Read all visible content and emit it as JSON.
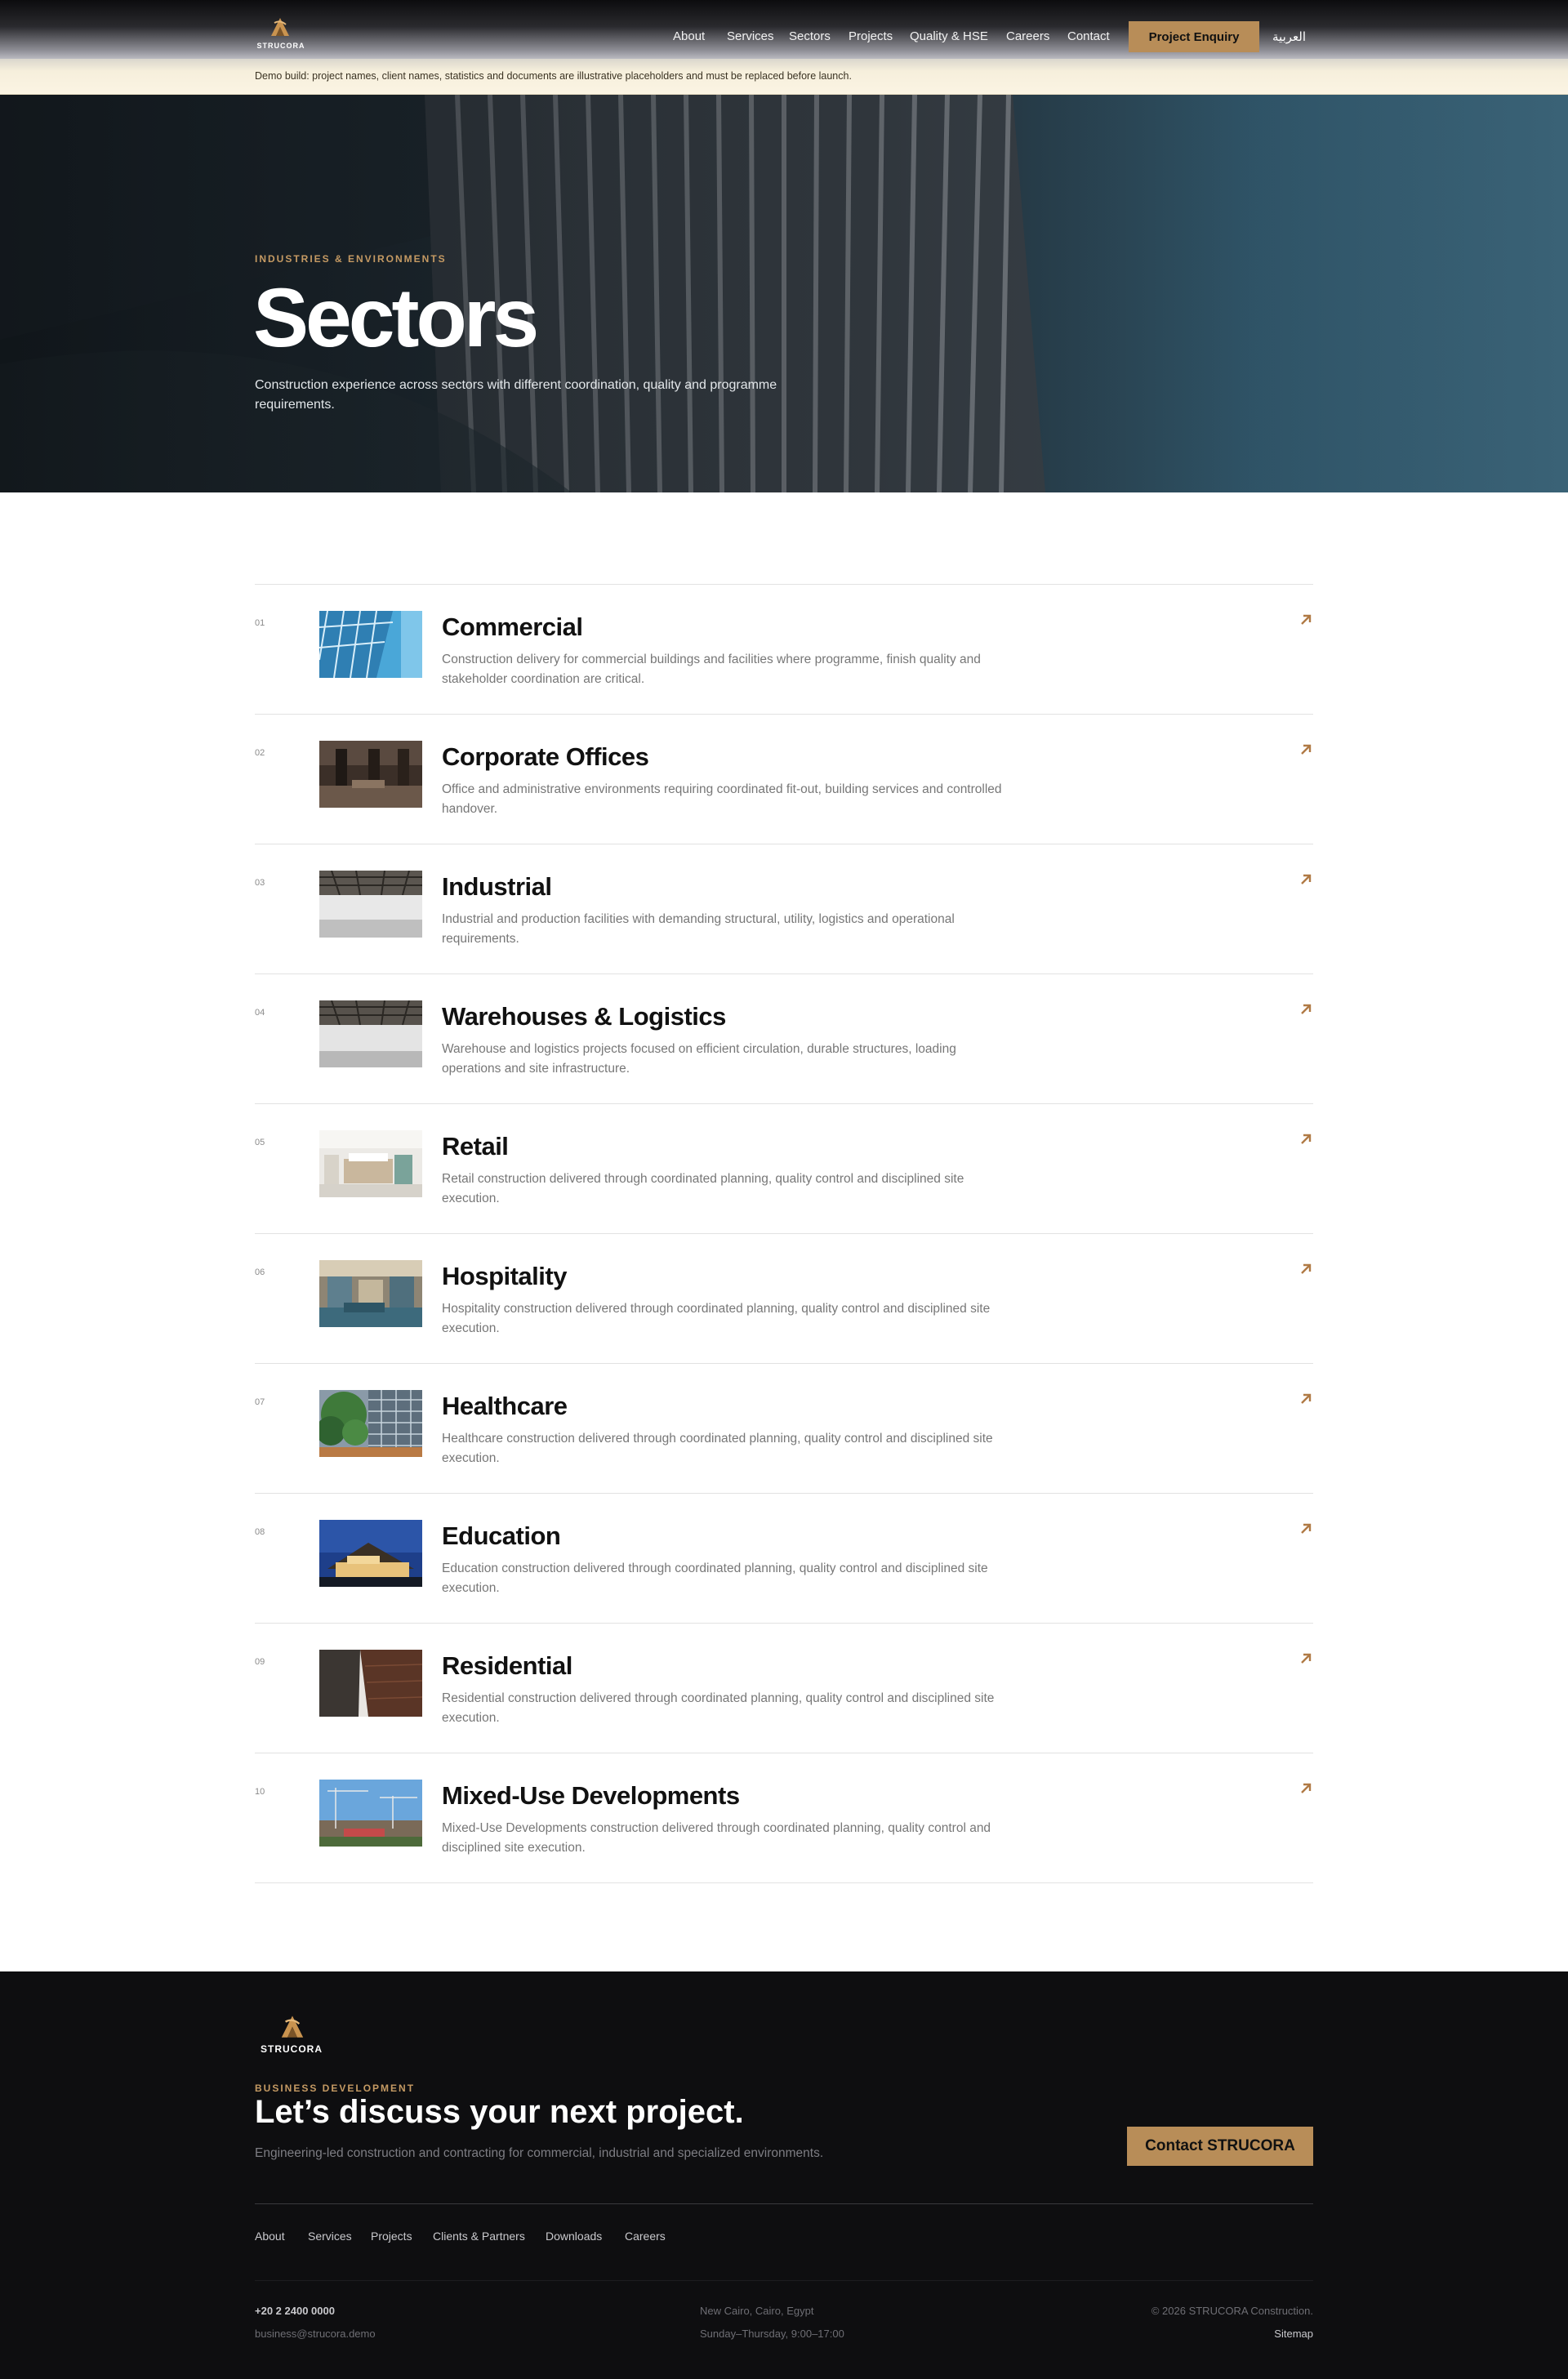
{
  "header": {
    "logo_text": "STRUCORA",
    "nav": [
      "About",
      "Services",
      "Sectors",
      "Projects",
      "Quality & HSE",
      "Careers",
      "Contact"
    ],
    "cta_label": "Project Enquiry",
    "language_label": "العربية"
  },
  "notice": {
    "text": "Demo build: project names, client names, statistics and documents are illustrative placeholders and must be replaced before launch."
  },
  "hero": {
    "eyebrow": "INDUSTRIES & ENVIRONMENTS",
    "title": "Sectors",
    "description": "Construction experience across sectors with different coordination, quality and programme requirements."
  },
  "sectors": [
    {
      "num": "01",
      "title": "Commercial",
      "description": "Construction delivery for commercial buildings and facilities where programme, finish quality and stakeholder coordination are critical."
    },
    {
      "num": "02",
      "title": "Corporate Offices",
      "description": "Office and administrative environments requiring coordinated fit-out, building services and controlled handover."
    },
    {
      "num": "03",
      "title": "Industrial",
      "description": "Industrial and production facilities with demanding structural, utility, logistics and operational requirements."
    },
    {
      "num": "04",
      "title": "Warehouses & Logistics",
      "description": "Warehouse and logistics projects focused on efficient circulation, durable structures, loading operations and site infrastructure."
    },
    {
      "num": "05",
      "title": "Retail",
      "description": "Retail construction delivered through coordinated planning, quality control and disciplined site execution."
    },
    {
      "num": "06",
      "title": "Hospitality",
      "description": "Hospitality construction delivered through coordinated planning, quality control and disciplined site execution."
    },
    {
      "num": "07",
      "title": "Healthcare",
      "description": "Healthcare construction delivered through coordinated planning, quality control and disciplined site execution."
    },
    {
      "num": "08",
      "title": "Education",
      "description": "Education construction delivered through coordinated planning, quality control and disciplined site execution."
    },
    {
      "num": "09",
      "title": "Residential",
      "description": "Residential construction delivered through coordinated planning, quality control and disciplined site execution."
    },
    {
      "num": "10",
      "title": "Mixed-Use Developments",
      "description": "Mixed-Use Developments construction delivered through coordinated planning, quality control and disciplined site execution."
    }
  ],
  "footer": {
    "logo_text": "STRUCORA",
    "eyebrow": "BUSINESS DEVELOPMENT",
    "title": "Let’s discuss your next project.",
    "description": "Engineering-led construction and contracting for commercial, industrial and specialized environments.",
    "cta_label": "Contact STRUCORA",
    "links": [
      "About",
      "Services",
      "Projects",
      "Clients & Partners",
      "Downloads",
      "Careers"
    ],
    "phone": "+20 2 2400 0000",
    "email": "business@strucora.demo",
    "address": "New Cairo, Cairo, Egypt",
    "hours": "Sunday–Thursday, 9:00–17:00",
    "copyright": "© 2026 STRUCORA Construction.",
    "sitemap": "Sitemap"
  },
  "colors": {
    "accent": "#b88d58",
    "eyebrow": "#c59a63",
    "footer_bg": "#0e0e10"
  }
}
